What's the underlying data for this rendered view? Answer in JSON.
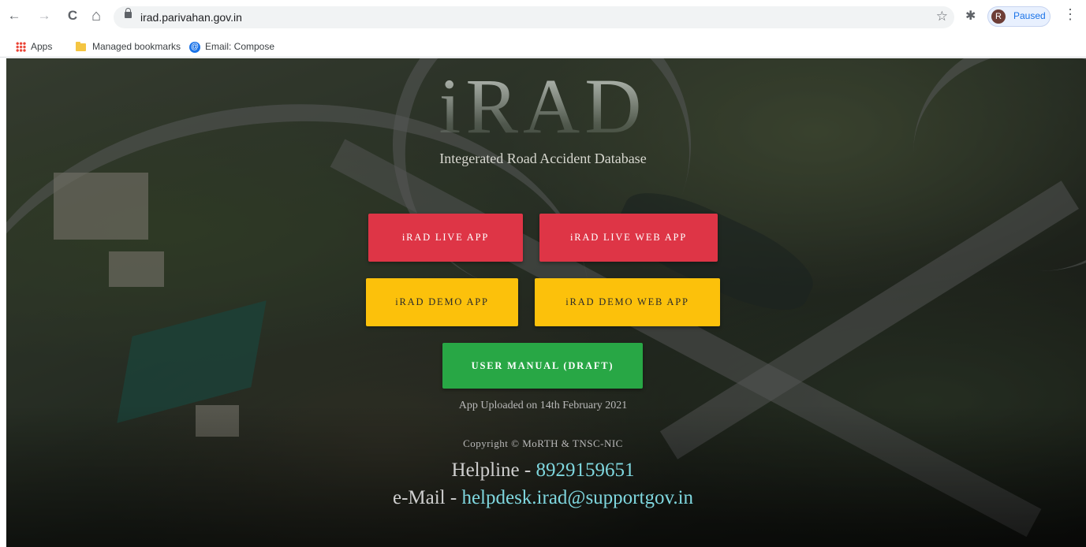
{
  "browser": {
    "url": "irad.parivahan.gov.in",
    "profile_initial": "R",
    "profile_status": "Paused",
    "nav": {
      "back": "←",
      "forward": "→",
      "reload": "C",
      "home": "⌂"
    },
    "icons": {
      "bookmark_star": "☆",
      "extensions": "✱",
      "menu": "⋮"
    }
  },
  "bookmarks": [
    {
      "label": "Apps",
      "icon": "apps-grid-icon"
    },
    {
      "label": "Managed bookmarks",
      "icon": "folder-icon"
    },
    {
      "label": "Email: Compose",
      "icon": "mail-icon",
      "icon_glyph": "@"
    }
  ],
  "hero": {
    "logo_text": "iRAD",
    "tagline": "Integerated Road Accident Database",
    "buttons": {
      "live_app": "iRAD LIVE APP",
      "live_web_app": "iRAD LIVE WEB APP",
      "demo_app": "iRAD DEMO APP",
      "demo_web_app": "iRAD DEMO WEB APP",
      "user_manual": "USER MANUAL (DRAFT)"
    },
    "uploaded_note": "App Uploaded on 14th February 2021",
    "copyright": "Copyright © MoRTH & TNSC-NIC",
    "helpline_label": "Helpline - ",
    "helpline_number": "8929159651",
    "email_label": "e-Mail - ",
    "email_address": "helpdesk.irad@supportgov.in"
  },
  "colors": {
    "live_button": "#de3546",
    "demo_button": "#fcc10b",
    "manual_button": "#28a745",
    "contact_accent": "#7fd7df"
  }
}
